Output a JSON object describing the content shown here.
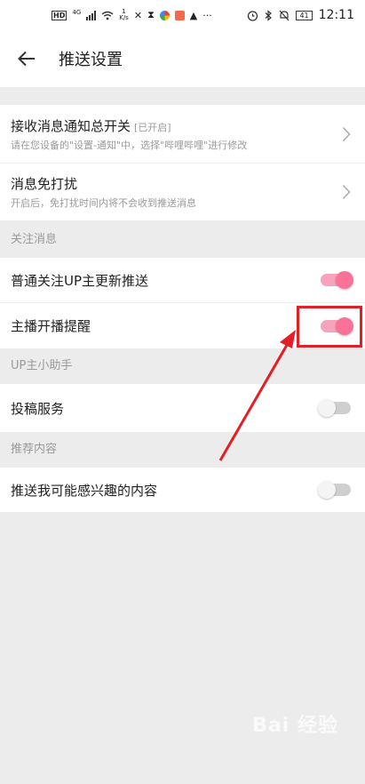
{
  "status_bar": {
    "network": "4G",
    "speed_value": "1",
    "speed_unit": "K/s",
    "more": "···",
    "time": "12:11",
    "battery": "41"
  },
  "header": {
    "title": "推送设置"
  },
  "top_group": {
    "items": [
      {
        "label": "接收消息通知总开关",
        "tag": "[已开启]",
        "desc": "请在您设备的\"设置-通知\"中，选择\"哔哩哔哩\"进行修改"
      },
      {
        "label": "消息免打扰",
        "desc": "开启后，免打扰时间内将不会收到推送消息"
      }
    ]
  },
  "sections": [
    {
      "title": "关注消息",
      "items": [
        {
          "label": "普通关注UP主更新推送",
          "enabled": true
        },
        {
          "label": "主播开播提醒",
          "enabled": true
        }
      ]
    },
    {
      "title": "UP主小助手",
      "items": [
        {
          "label": "投稿服务",
          "enabled": false
        }
      ]
    },
    {
      "title": "推荐内容",
      "items": [
        {
          "label": "推送我可能感兴趣的内容",
          "enabled": false
        }
      ]
    }
  ],
  "annotation": {
    "color": "#e31e24"
  },
  "watermark": "Bai 经验",
  "colors": {
    "accent": "#fb7299",
    "background": "#ececec"
  }
}
